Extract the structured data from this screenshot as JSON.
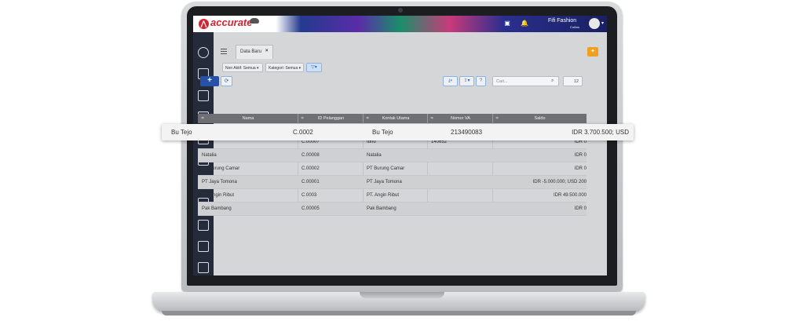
{
  "app": {
    "user_name": "Fifi Fashion",
    "user_sub": "Collins"
  },
  "tab": {
    "label": "Data Baru",
    "close": "×"
  },
  "filters": {
    "status": "Non Aktif: Semua",
    "category": "Kategori: Semua"
  },
  "toolbar": {
    "add": "+",
    "refresh": "⟳",
    "search_placeholder": "Cari...",
    "count": "12"
  },
  "table": {
    "columns": [
      "Nama",
      "ID Pelanggan",
      "Kontak Utama",
      "Nomor VA",
      "Saldo"
    ],
    "highlight": {
      "nama": "Bu Tejo",
      "id": "C.0002",
      "kontak": "Bu Tejo",
      "va": "213490083",
      "saldo": "IDR 3.700.500; USD"
    },
    "rows": [
      {
        "nama": "Ibnu",
        "id": "C.00007",
        "kontak": "Ibnu",
        "va": "140652",
        "saldo": "IDR 0"
      },
      {
        "nama": "Natalia",
        "id": "C.00008",
        "kontak": "Natalia",
        "va": "",
        "saldo": "IDR 0"
      },
      {
        "nama": "PT Burung Camar",
        "id": "C.00002",
        "kontak": "PT Burung Camar",
        "va": "",
        "saldo": "IDR 0"
      },
      {
        "nama": "PT Jaya Tomona",
        "id": "C.00001",
        "kontak": "PT Jaya Tomona",
        "va": "",
        "saldo": "IDR -5.000.000; USD 200"
      },
      {
        "nama": "PT. Angin Ribut",
        "id": "C.0003",
        "kontak": "PT. Angin Ribut",
        "va": "",
        "saldo": "IDR 49.500.000"
      },
      {
        "nama": "Pak Bambang",
        "id": "C.00005",
        "kontak": "Pak Bambang",
        "va": "",
        "saldo": "IDR 0"
      }
    ]
  }
}
